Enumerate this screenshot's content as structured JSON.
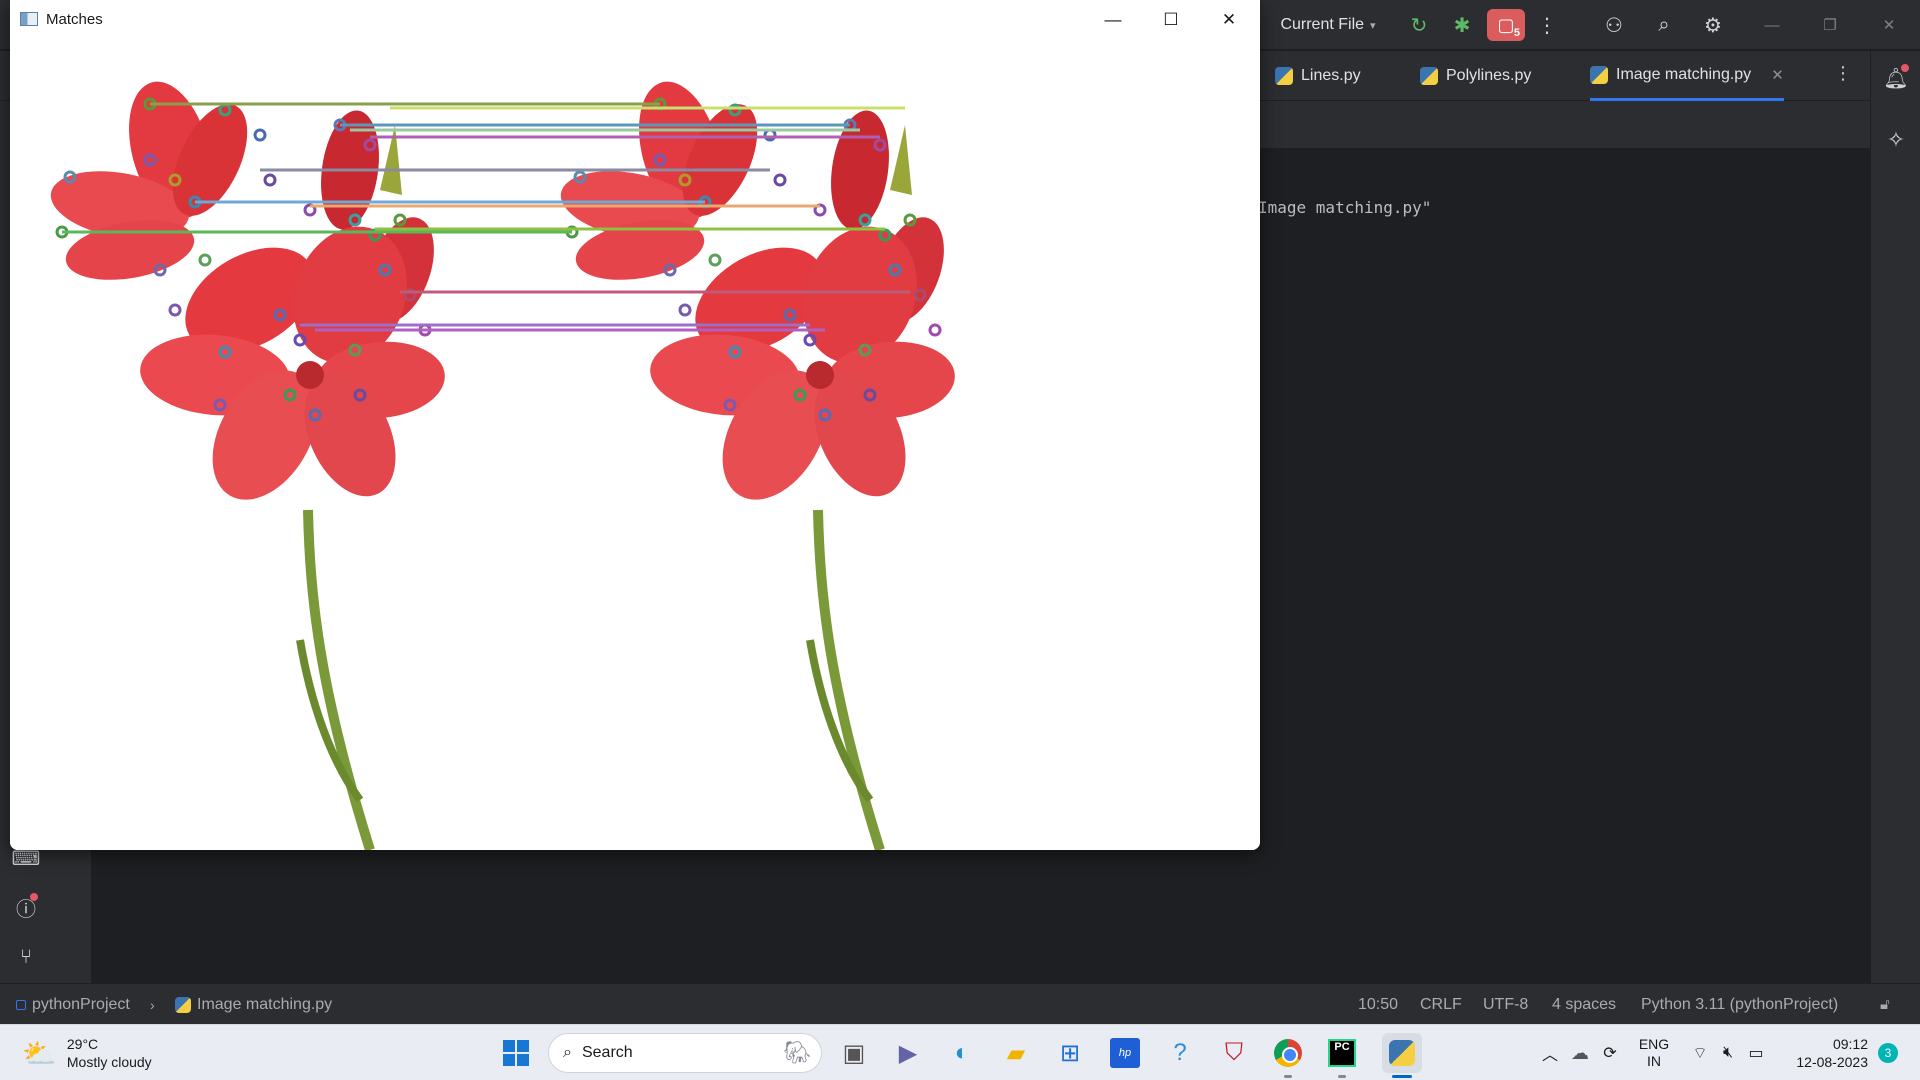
{
  "ide": {
    "toolbar": {
      "run_config": "Current File",
      "stop_count": "5",
      "icons": [
        "run-icon",
        "debug-icon",
        "stop-icon",
        "more-icon",
        "profile-icon",
        "search-icon",
        "gear-icon"
      ]
    },
    "tabs": [
      {
        "label": "Lines.py",
        "icon": "python-file-icon"
      },
      {
        "label": "Polylines.py",
        "icon": "python-file-icon"
      },
      {
        "label": "Image matching.py",
        "icon": "python-file-icon",
        "active": true
      }
    ],
    "editor_text": "Image matching.py\"",
    "status_bar": {
      "project": "pythonProject",
      "file": "Image matching.py",
      "position": "10:50",
      "line_ending": "CRLF",
      "encoding": "UTF-8",
      "indent": "4 spaces",
      "interpreter": "Python 3.11 (pythonProject)"
    }
  },
  "matches_window": {
    "title": "Matches",
    "content": "Two copies of a red lily image side by side with keypoint circles and horizontal match lines connecting corresponding keypoints"
  },
  "taskbar": {
    "weather": {
      "temp": "29°C",
      "condition": "Mostly cloudy"
    },
    "search_label": "Search",
    "pinned_apps": [
      "task-view",
      "teams",
      "edge",
      "file-explorer",
      "microsoft-store",
      "myhp",
      "get-help",
      "mcafee",
      "chrome",
      "pycharm",
      "python"
    ],
    "tray": {
      "language": "ENG",
      "region": "IN",
      "time": "09:12",
      "date": "12-08-2023",
      "notification_count": "3"
    }
  },
  "colors": {
    "ide_bg": "#1e1f22",
    "ide_panel": "#2b2d30",
    "accent": "#3574f0",
    "stop_red": "#db5c5c",
    "flower_red": "#e63a3f",
    "taskbar_bg": "#e9edf3"
  }
}
